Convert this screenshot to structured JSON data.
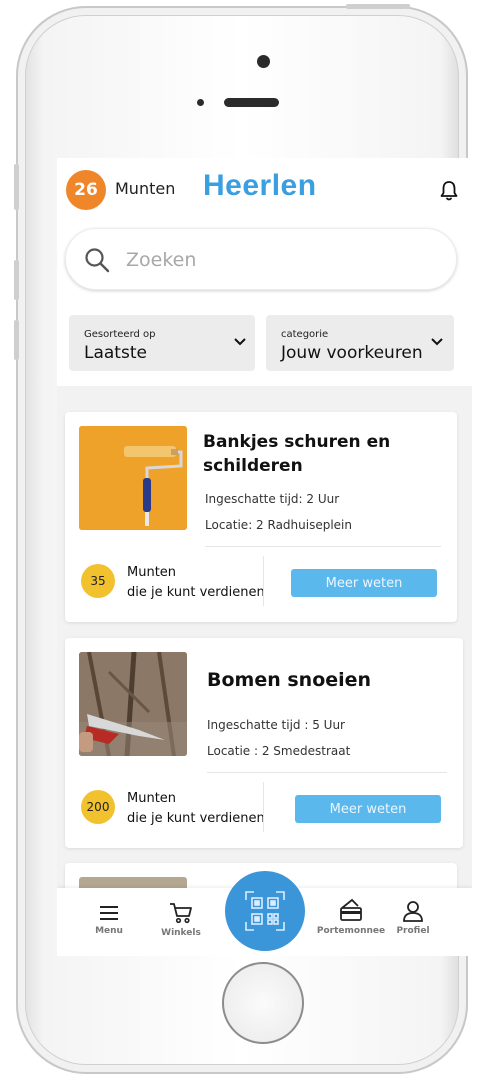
{
  "header": {
    "coins": "26",
    "coins_label": "Munten",
    "city": "Heerlen"
  },
  "search": {
    "placeholder": "Zoeken"
  },
  "filters": {
    "sort": {
      "small_label": "Gesorteerd op",
      "value": "Laatste"
    },
    "category": {
      "small_label": "categorie",
      "value": "Jouw voorkeuren"
    }
  },
  "tasks": [
    {
      "title_line1": "Bankjes schuren en",
      "title_line2": "schilderen",
      "time": "Ingeschatte tijd: 2 Uur",
      "location": "Locatie: 2 Radhuiseplein",
      "reward": "35",
      "reward_line1": "Munten",
      "reward_line2": "die je kunt verdienen",
      "button": "Meer weten"
    },
    {
      "title_line1": "Bomen snoeien",
      "time": "Ingeschatte tijd : 5 Uur",
      "location": "Locatie : 2 Smedestraat",
      "reward": "200",
      "reward_line1": "Munten",
      "reward_line2": "die je kunt verdienen",
      "button": "Meer weten"
    }
  ],
  "tabbar": {
    "menu": "Menu",
    "shops": "Winkels",
    "wallet": "Portemonnee",
    "profile": "Profiel"
  },
  "colors": {
    "accent": "#3a9fe0",
    "coin_badge": "#f0862a",
    "reward_badge": "#f2c12e",
    "button": "#5bb8ec",
    "fab": "#3b95d9"
  },
  "icons": [
    "bell-icon",
    "search-icon",
    "chevron-down-icon",
    "menu-icon",
    "cart-icon",
    "qr-code-icon",
    "wallet-icon",
    "user-icon"
  ]
}
